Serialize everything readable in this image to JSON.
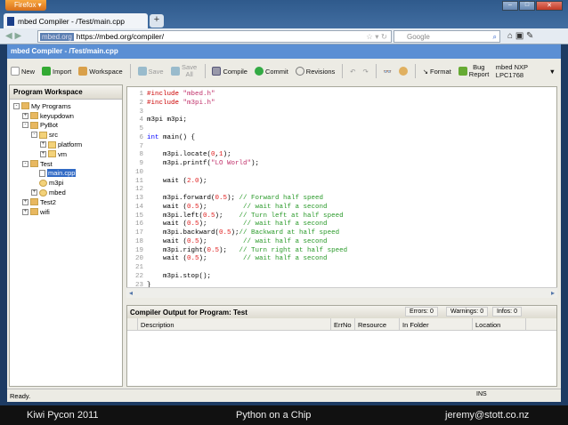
{
  "browser": {
    "menu": "Firefox",
    "tab_title": "mbed Compiler - /Test/main.cpp",
    "identity": "mbed.org",
    "url": "https://mbed.org/compiler/",
    "search_placeholder": "Google"
  },
  "app": {
    "title": "mbed Compiler - /Test/main.cpp",
    "toolbar": {
      "new": "New",
      "import": "Import",
      "workspace": "Workspace",
      "save": "Save",
      "save_all": "Save All",
      "compile": "Compile",
      "commit": "Commit",
      "revisions": "Revisions",
      "format": "Format",
      "bug_report": "Bug Report",
      "platform": "mbed NXP LPC1768"
    },
    "workspace": {
      "title": "Program Workspace",
      "tree": [
        "My Programs",
        "keyupdown",
        "PyBot",
        "src",
        "platform",
        "vm",
        "Test",
        "main.cpp",
        "m3pi",
        "mbed",
        "Test2",
        "wifi"
      ]
    },
    "code": [
      [
        [
          "pp",
          "#include "
        ],
        [
          "st",
          "\"mbed.h\""
        ]
      ],
      [
        [
          "pp",
          "#include "
        ],
        [
          "st",
          "\"m3pi.h\""
        ]
      ],
      [],
      [
        [
          "",
          "m3pi m3pi;"
        ]
      ],
      [],
      [
        [
          "kw",
          "int"
        ],
        [
          "",
          " main() {"
        ]
      ],
      [],
      [
        [
          "",
          "    m3pi.locate("
        ],
        [
          "nb",
          "0"
        ],
        [
          "",
          ","
        ],
        [
          "nb",
          "1"
        ],
        [
          "",
          ");"
        ]
      ],
      [
        [
          "",
          "    m3pi.printf("
        ],
        [
          "st",
          "\"LO World\""
        ],
        [
          "",
          ");"
        ]
      ],
      [],
      [
        [
          "",
          "    wait ("
        ],
        [
          "nb",
          "2.0"
        ],
        [
          "",
          ");"
        ]
      ],
      [],
      [
        [
          "",
          "    m3pi.forward("
        ],
        [
          "nb",
          "0.5"
        ],
        [
          "",
          "); "
        ],
        [
          "cm",
          "// Forward half speed"
        ]
      ],
      [
        [
          "",
          "    wait ("
        ],
        [
          "nb",
          "0.5"
        ],
        [
          "",
          ");         "
        ],
        [
          "cm",
          "// wait half a second"
        ]
      ],
      [
        [
          "",
          "    m3pi.left("
        ],
        [
          "nb",
          "0.5"
        ],
        [
          "",
          ");    "
        ],
        [
          "cm",
          "// Turn left at half speed"
        ]
      ],
      [
        [
          "",
          "    wait ("
        ],
        [
          "nb",
          "0.5"
        ],
        [
          "",
          ");         "
        ],
        [
          "cm",
          "// wait half a second"
        ]
      ],
      [
        [
          "",
          "    m3pi.backward("
        ],
        [
          "nb",
          "0.5"
        ],
        [
          "",
          ");"
        ],
        [
          "cm",
          "// Backward at half speed"
        ]
      ],
      [
        [
          "",
          "    wait ("
        ],
        [
          "nb",
          "0.5"
        ],
        [
          "",
          ");         "
        ],
        [
          "cm",
          "// wait half a second"
        ]
      ],
      [
        [
          "",
          "    m3pi.right("
        ],
        [
          "nb",
          "0.5"
        ],
        [
          "",
          ");   "
        ],
        [
          "cm",
          "// Turn right at half speed"
        ]
      ],
      [
        [
          "",
          "    wait ("
        ],
        [
          "nb",
          "0.5"
        ],
        [
          "",
          ");         "
        ],
        [
          "cm",
          "// wait half a second"
        ]
      ],
      [],
      [
        [
          "",
          "    m3pi.stop();"
        ]
      ],
      [
        [
          "",
          "}"
        ]
      ]
    ],
    "output": {
      "title": "Compiler Output for Program: Test",
      "errors": "Errors: 0",
      "warnings": "Warnings: 0",
      "infos": "Infos: 0",
      "columns": [
        "Description",
        "ErrNo",
        "Resource",
        "In Folder",
        "Location"
      ]
    },
    "status": "Ready.",
    "mode": "INS"
  },
  "footer": {
    "left": "Kiwi Pycon 2011",
    "center": "Python on a Chip",
    "right": "jeremy@stott.co.nz"
  }
}
